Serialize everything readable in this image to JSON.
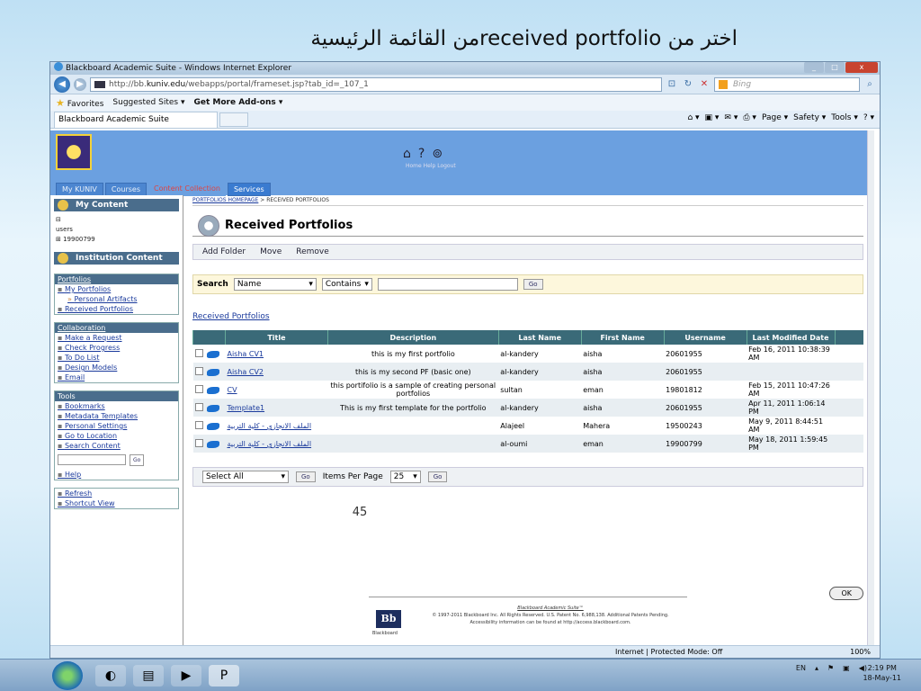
{
  "slide": {
    "title": "اختر من received portfolioمن القائمة الرئيسية",
    "subtitle": "",
    "page_number": "45"
  },
  "browser": {
    "window_title": "Blackboard Academic Suite - Windows Internet Explorer",
    "min": "_",
    "restore": "□",
    "close": "x",
    "url_prefix": "http://bb.",
    "url_host": "kuniv.edu",
    "url_path": "/webapps/portal/frameset.jsp?tab_id=_107_1",
    "search_placeholder": "Bing",
    "favorites": "Favorites",
    "suggested_sites": "Suggested Sites ▾",
    "get_addons": "Get More Add-ons ▾",
    "tab_title": "Blackboard Academic Suite",
    "page_menu": "Page ▾",
    "safety_menu": "Safety ▾",
    "tools_menu": "Tools ▾",
    "zone": "Internet | Protected Mode: Off",
    "zoom": "100%"
  },
  "bb": {
    "header_links": "Home Help Logout",
    "tabs": [
      "My KUNIV",
      "Courses",
      "Content Collection",
      "Services"
    ]
  },
  "nav": {
    "my_content": "My Content",
    "tree_toggle": "⊟",
    "tree": [
      "users",
      "⊞ 19900799"
    ],
    "institution_content": "Institution Content",
    "portfolios": {
      "heading": "Portfolios",
      "items": [
        "My Portfolios",
        "Personal Artifacts",
        "Received Portfolios"
      ]
    },
    "collaboration": {
      "heading": "Collaboration",
      "items": [
        "Make a Request",
        "Check Progress",
        "To Do List",
        "Design Models",
        "Email"
      ]
    },
    "tools": {
      "heading": "Tools",
      "items": [
        "Bookmarks",
        "Metadata Templates",
        "Personal Settings",
        "Go to Location",
        "Search Content"
      ],
      "help": "Help"
    },
    "go": "Go",
    "refresh": "Refresh",
    "shortcut_view": "Shortcut View"
  },
  "main": {
    "breadcrumb": [
      "PORTFOLIOS HOMEPAGE",
      "RECEIVED PORTFOLIOS"
    ],
    "breadcrumb_sep": " > ",
    "title": "Received Portfolios",
    "actions": [
      "Add Folder",
      "Move",
      "Remove"
    ],
    "search": {
      "label": "Search",
      "field": "Name",
      "operator": "Contains",
      "go": "Go"
    },
    "received_link": "Received Portfolios",
    "columns": [
      "Title",
      "Description",
      "Last Name",
      "First Name",
      "Username",
      "Last Modified Date"
    ],
    "rows": [
      {
        "title": "Aisha CV1",
        "description": "this is my first portfolio",
        "last_name": "al-kandery",
        "first_name": "aisha",
        "username": "20601955",
        "modified": "Feb 16, 2011 10:38:39 AM"
      },
      {
        "title": "Aisha CV2",
        "description": "this is my second PF (basic one)",
        "last_name": "al-kandery",
        "first_name": "aisha",
        "username": "20601955",
        "modified": ""
      },
      {
        "title": "CV",
        "description": "this portifolio is a sample of creating personal portfolios",
        "last_name": "sultan",
        "first_name": "eman",
        "username": "19801812",
        "modified": "Feb 15, 2011 10:47:26 AM"
      },
      {
        "title": "Template1",
        "description": "This is my first template for the portfolio",
        "last_name": "al-kandery",
        "first_name": "aisha",
        "username": "20601955",
        "modified": "Apr 11, 2011 1:06:14 PM"
      },
      {
        "title": "الملف الانجازي - كلية التربية",
        "description": "",
        "last_name": "Alajeel",
        "first_name": "Mahera",
        "username": "19500243",
        "modified": "May 9, 2011 8:44:51 AM"
      },
      {
        "title": "الملف الانجازي - كلية التربية",
        "description": "",
        "last_name": "al-oumi",
        "first_name": "eman",
        "username": "19900799",
        "modified": "May 18, 2011 1:59:45 PM"
      }
    ],
    "bottom": {
      "select_all": "Select All",
      "go": "Go",
      "items_per_page": "Items Per Page",
      "per_page_value": "25"
    },
    "ok": "OK"
  },
  "footer": {
    "logo": "Bb",
    "logo_caption": "Blackboard",
    "product": "Blackboard Academic Suite™",
    "copyright": "© 1997-2011 Blackboard Inc. All Rights Reserved. U.S. Patent No. 6,988,138. Additional Patents Pending.",
    "accessibility": "Accessibility information can be found at http://access.blackboard.com."
  },
  "taskbar": {
    "lang": "EN",
    "time": "2:19 PM",
    "date": "18-May-11"
  },
  "colors": {
    "bb_header": "#6ba0e0",
    "nav_header": "#4a6d8c",
    "table_header": "#3a6a78",
    "highlight_circle": "#c0392b"
  }
}
